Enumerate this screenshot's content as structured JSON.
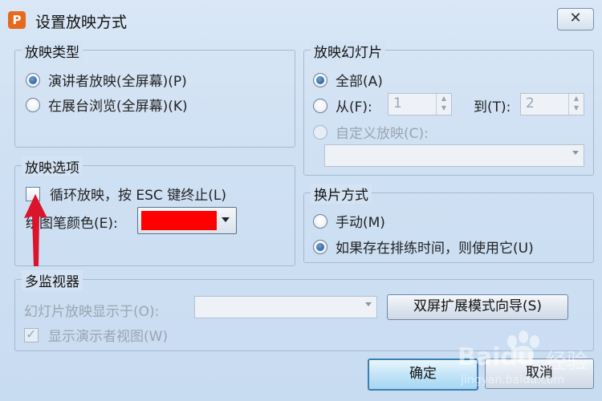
{
  "window": {
    "title": "设置放映方式",
    "app_icon": "P",
    "close_symbol": "✕"
  },
  "show_type": {
    "title": "放映类型",
    "options": [
      {
        "label": "演讲者放映(全屏幕)(P)",
        "checked": true
      },
      {
        "label": "在展台浏览(全屏幕)(K)",
        "checked": false
      }
    ]
  },
  "slides": {
    "title": "放映幻灯片",
    "all_label": "全部(A)",
    "from_label": "从(F):",
    "from_value": "1",
    "to_label": "到(T):",
    "to_value": "2",
    "custom_label": "自定义放映(C):"
  },
  "show_options": {
    "title": "放映选项",
    "loop_label": "循环放映，按 ESC 键终止(L)",
    "pen_color_label": "绘图笔颜色(E):",
    "pen_color": "#ff0000"
  },
  "advance": {
    "title": "换片方式",
    "manual_label": "手动(M)",
    "timing_label": "如果存在排练时间，则使用它(U)"
  },
  "monitors": {
    "title": "多监视器",
    "display_label": "幻灯片放映显示于(O):",
    "dual_screen_button": "双屏扩展模式向导(S)",
    "presenter_view_label": "显示演示者视图(W)"
  },
  "footer": {
    "ok_label": "确定",
    "cancel_label": "取消"
  },
  "watermark": {
    "brand": "Baidu",
    "suffix": "经验",
    "url": "jingyan.baidu.com"
  },
  "colors": {
    "accent": "#3c7fb1",
    "annotation_arrow": "#d9142b"
  }
}
